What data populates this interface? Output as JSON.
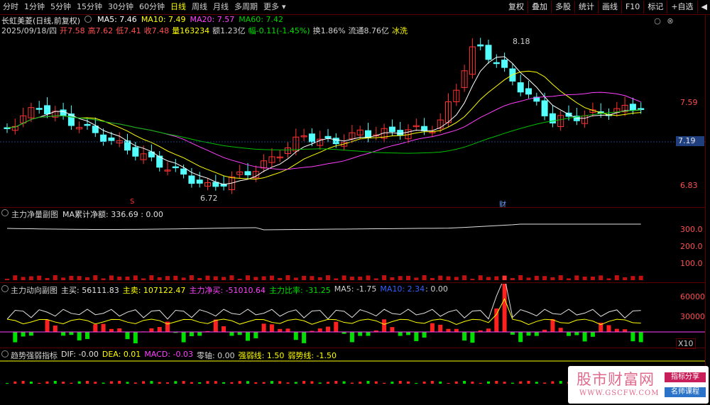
{
  "toolbar": {
    "tabs": [
      {
        "label": "分时",
        "active": false
      },
      {
        "label": "1分钟",
        "active": false
      },
      {
        "label": "5分钟",
        "active": false
      },
      {
        "label": "15分钟",
        "active": false
      },
      {
        "label": "30分钟",
        "active": false
      },
      {
        "label": "60分钟",
        "active": false
      },
      {
        "label": "日线",
        "active": true
      },
      {
        "label": "周线",
        "active": false
      },
      {
        "label": "月线",
        "active": false
      },
      {
        "label": "多周期",
        "active": false
      },
      {
        "label": "更多",
        "active": false
      }
    ],
    "more_arrow": "▾",
    "right_buttons": [
      "复权",
      "叠加",
      "多股",
      "统计",
      "画线",
      "F10",
      "标记",
      "+自选",
      "◀"
    ]
  },
  "header": {
    "title": "长虹美菱(日线,前复权)",
    "ma5": "MA5: 7.46",
    "ma10": "MA10: 7.49",
    "ma20": "MA20: 7.57",
    "ma60": "MA60: 7.42",
    "date": "2025/09/18/四",
    "open": "开7.58",
    "high": "高7.62",
    "low": "低7.41",
    "close": "收7.48",
    "volume": "量163234",
    "amount": "额1.23亿",
    "change": "幅-0.11(-1.45%)",
    "turnover": "换1.86%",
    "float_value": "流通8.76亿",
    "sector": "冰洗"
  },
  "main_chart": {
    "axis_labels": [
      "7.59",
      "6.83"
    ],
    "current_price": "7.19",
    "high_marker": "8.18",
    "low_marker": "6.72",
    "marker_s": "S",
    "marker_cai": "财",
    "colors": {
      "up": "#ff3232",
      "down": "#54ffff",
      "ma5": "#ffffff",
      "ma10": "#ffff00",
      "ma20": "#ff40ff",
      "ma60": "#00c000"
    }
  },
  "panel1": {
    "title": "主力净量副图",
    "value": "MA累计净额: 336.69 : 0.00",
    "axis_labels": [
      "300.0",
      "200.0",
      "100.0"
    ]
  },
  "panel2": {
    "title": "主力动向副图",
    "buy": "主买: 56111.83",
    "sell": "主卖: 107122.47",
    "net": "主力净买: -51010.64",
    "ratio": "主力比率: -31.25",
    "ma5": "MA5: -1.75",
    "ma10": "MA10: 2.34",
    "tail": ": 0.00",
    "axis_labels": [
      "60000",
      "30000"
    ],
    "scale": "X10"
  },
  "panel3": {
    "title": "趋势强弱指标",
    "dif": "DIF: -0.00",
    "dea": "DEA: 0.01",
    "macd": "MACD: -0.03",
    "zero": "零轴: 0.00",
    "strong": "强弱线: 1.50",
    "weak": "弱势线: -1.50"
  },
  "watermark": {
    "title": "股市财富网",
    "url": "WWW.GSCFW.COM",
    "badge1": "指标分享",
    "badge2": "名师课程"
  }
}
